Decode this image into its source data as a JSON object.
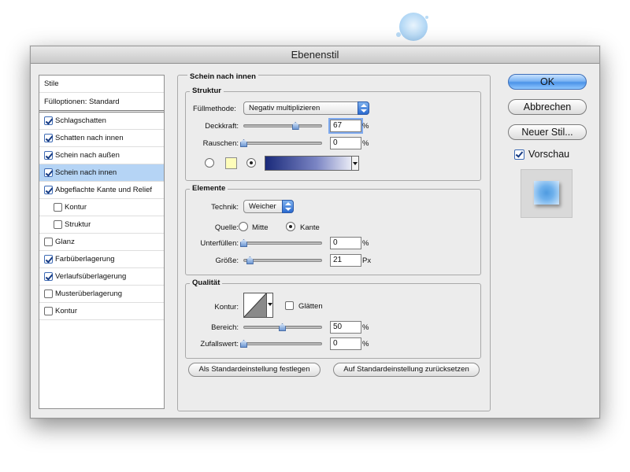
{
  "window": {
    "title": "Ebenenstil"
  },
  "style_list": {
    "header": "Stile",
    "blend_options": "Fülloptionen: Standard",
    "items": [
      {
        "label": "Schlagschatten",
        "checked": true
      },
      {
        "label": "Schatten nach innen",
        "checked": true
      },
      {
        "label": "Schein nach außen",
        "checked": true
      },
      {
        "label": "Schein nach innen",
        "checked": true,
        "selected": true
      },
      {
        "label": "Abgeflachte Kante und Relief",
        "checked": true
      },
      {
        "label": "Kontur",
        "checked": false,
        "sub": true
      },
      {
        "label": "Struktur",
        "checked": false,
        "sub": true
      },
      {
        "label": "Glanz",
        "checked": false
      },
      {
        "label": "Farbüberlagerung",
        "checked": true
      },
      {
        "label": "Verlaufsüberlagerung",
        "checked": true
      },
      {
        "label": "Musterüberlagerung",
        "checked": false
      },
      {
        "label": "Kontur",
        "checked": false
      }
    ]
  },
  "panel": {
    "title": "Schein nach innen",
    "struktur": {
      "title": "Struktur",
      "blend_mode_label": "Füllmethode:",
      "blend_mode_value": "Negativ multiplizieren",
      "opacity_label": "Deckkraft:",
      "opacity_value": "67",
      "opacity_level": 0.67,
      "opacity_unit": "%",
      "noise_label": "Rauschen:",
      "noise_value": "0",
      "noise_level": 0,
      "noise_unit": "%",
      "swatch_color": "#fefdba",
      "gradient_start": "#1a2a7a",
      "gradient_end": "#ffffff"
    },
    "elemente": {
      "title": "Elemente",
      "technique_label": "Technik:",
      "technique_value": "Weicher",
      "source_label": "Quelle:",
      "source_center": "Mitte",
      "source_edge": "Kante",
      "source_selected": "Kante",
      "choke_label": "Unterfüllen:",
      "choke_value": "0",
      "choke_level": 0,
      "choke_unit": "%",
      "size_label": "Größe:",
      "size_value": "21",
      "size_level": 0.08,
      "size_unit": "Px"
    },
    "qualitaet": {
      "title": "Qualität",
      "contour_label": "Kontur:",
      "antialias_label": "Glätten",
      "antialias_checked": false,
      "range_label": "Bereich:",
      "range_value": "50",
      "range_level": 0.5,
      "range_unit": "%",
      "jitter_label": "Zufallswert:",
      "jitter_value": "0",
      "jitter_level": 0,
      "jitter_unit": "%"
    },
    "buttons": {
      "make_default": "Als Standardeinstellung festlegen",
      "reset_default": "Auf Standardeinstellung zurücksetzen"
    }
  },
  "actions": {
    "ok": "OK",
    "cancel": "Abbrechen",
    "new_style": "Neuer Stil...",
    "preview_label": "Vorschau",
    "preview_checked": true
  },
  "colors": {
    "accent": "#4b93e8",
    "selection": "#b5d4f5",
    "preview_fill": "#6fb1ec"
  }
}
